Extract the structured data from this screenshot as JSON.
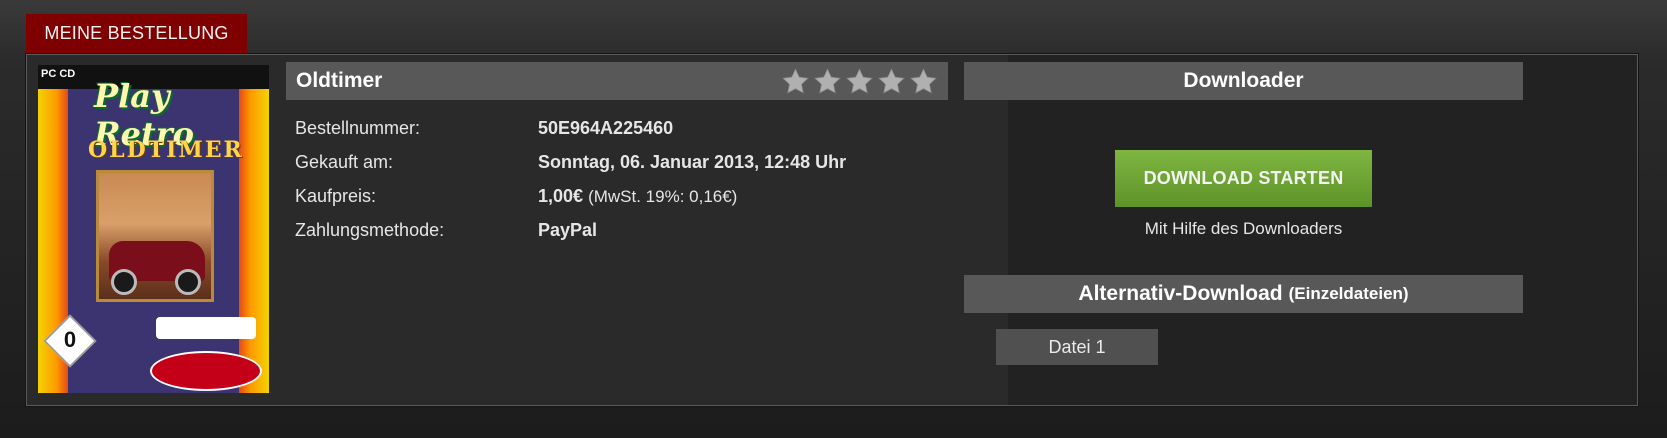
{
  "section": {
    "title": "MEINE BESTELLUNG"
  },
  "product": {
    "title": "Oldtimer",
    "rating": 5,
    "rating_color": "#b0b0b0",
    "cover": {
      "platform": "PC CD",
      "brand": "Play Retro",
      "game_title": "OLDTIMER"
    }
  },
  "details": [
    {
      "label": "Bestellnummer:",
      "value": "50E964A225460",
      "note": ""
    },
    {
      "label": "Gekauft am:",
      "value": "Sonntag, 06. Januar 2013, 12:48 Uhr",
      "note": ""
    },
    {
      "label": "Kaufpreis:",
      "value": "1,00€",
      "note": "(MwSt. 19%: 0,16€)"
    },
    {
      "label": "Zahlungsmethode:",
      "value": "PayPal",
      "note": ""
    }
  ],
  "downloader": {
    "title": "Downloader",
    "button_label": "DOWNLOAD STARTEN",
    "hint": "Mit Hilfe des Downloaders"
  },
  "alternative": {
    "title": "Alternativ-Download",
    "suffix": "(Einzeldateien)",
    "files": [
      "Datei 1"
    ]
  },
  "colors": {
    "tab": "#7f0000",
    "header": "#585858",
    "button_green": "#6ea535",
    "file_button": "#505050"
  },
  "icons": {
    "rating": "star-icon"
  }
}
